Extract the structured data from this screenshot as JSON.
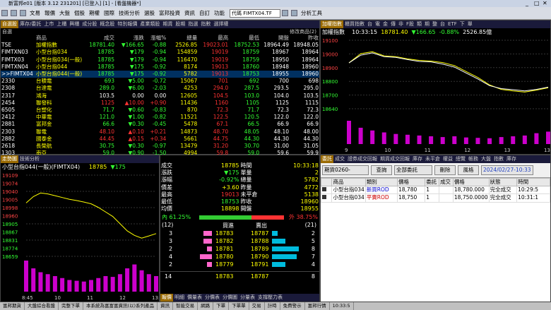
{
  "window": {
    "title": "新富邦e01 [版本 3.12 231201] [已登入] [1] - [看盤機器*]"
  },
  "menu": {
    "items": [
      "文易",
      "報價",
      "大盤",
      "個股",
      "期權",
      "國際",
      "技術分析",
      "選股",
      "富邦投資",
      "資訊",
      "自訂",
      "功能"
    ],
    "search_value": "代碼 FIMTX04.TF",
    "chart_label": "分析工具"
  },
  "quote": {
    "tabs": [
      "自選股",
      "庫存/委託",
      "上市",
      "上櫃",
      "興櫃",
      "成分股",
      "概念股",
      "特別報價",
      "產業類股",
      "期貨",
      "股期",
      "指選",
      "指數",
      "選擇權"
    ],
    "section_label": "自選",
    "date_label": "修改商品(2)",
    "headers": [
      "商品",
      "成交",
      "漲跌",
      "漲幅%",
      "總量",
      "最高",
      "最低",
      "開盤",
      "昨收"
    ],
    "rows": [
      {
        "code": "TSE",
        "name": "加權指數",
        "price": "18781.40",
        "chg": "▼166.65",
        "pct": "-0.88",
        "vol": "2526.85",
        "high": "19023.01",
        "low": "18752.53",
        "open": "18964.49",
        "prev": "18948.05"
      },
      {
        "code": "FIMTXN03",
        "name": "小型台指034",
        "price": "18785",
        "chg": "▼179",
        "pct": "-0.94",
        "vol": "154859",
        "high": "19019",
        "low": "18759",
        "open": "18967",
        "prev": "18964"
      },
      {
        "code": "FIMTX03",
        "name": "小型台指034(一般)",
        "price": "18785",
        "chg": "▼179",
        "pct": "-0.94",
        "vol": "116470",
        "high": "19019",
        "low": "18759",
        "open": "18950",
        "prev": "18964"
      },
      {
        "code": "FIMTXN04",
        "name": "小型台指044",
        "price": "18785",
        "chg": "▼175",
        "pct": "-0.92",
        "vol": "8174",
        "high": "19013",
        "low": "18760",
        "open": "18948",
        "prev": "18960"
      },
      {
        "code": ">>FIMTX04",
        "name": "小型台指044(一般)",
        "price": "18785",
        "chg": "▼175",
        "pct": "-0.92",
        "vol": "5782",
        "high": "19013",
        "low": "18753",
        "open": "18955",
        "prev": "18960"
      },
      {
        "code": "2330",
        "name": "台積電",
        "price": "693",
        "chg": "▼5.00",
        "pct": "-0.72",
        "vol": "15067",
        "high": "701",
        "low": "692",
        "open": "700",
        "prev": "698"
      },
      {
        "code": "2308",
        "name": "台達電",
        "price": "289.0",
        "chg": "▼6.00",
        "pct": "-2.03",
        "vol": "4253",
        "high": "294.0",
        "low": "287.5",
        "open": "293.5",
        "prev": "295.0"
      },
      {
        "code": "2317",
        "name": "鴻海",
        "price": "103.5",
        "chg": "0.00",
        "pct": "0.00",
        "vol": "12605",
        "high": "104.5",
        "low": "103.0",
        "open": "104.0",
        "prev": "103.5"
      },
      {
        "code": "2454",
        "name": "聯發科",
        "price": "1125",
        "chg": "▲10.00",
        "pct": "+0.90",
        "vol": "11436",
        "high": "1160",
        "low": "1105",
        "open": "1125",
        "prev": "1115"
      },
      {
        "code": "6505",
        "name": "台塑化",
        "price": "71.7",
        "chg": "▼0.60",
        "pct": "-0.83",
        "vol": "870",
        "high": "72.3",
        "low": "71.7",
        "open": "72.3",
        "prev": "72.3"
      },
      {
        "code": "2412",
        "name": "中華電",
        "price": "121.0",
        "chg": "▼1.00",
        "pct": "-0.82",
        "vol": "11521",
        "high": "122.5",
        "low": "120.5",
        "open": "122.0",
        "prev": "122.0"
      },
      {
        "code": "2881",
        "name": "富邦金",
        "price": "66.6",
        "chg": "▼0.30",
        "pct": "-0.45",
        "vol": "5478",
        "high": "67.1",
        "low": "66.5",
        "open": "66.9",
        "prev": "66.9"
      },
      {
        "code": "2303",
        "name": "聯電",
        "price": "48.10",
        "chg": "▲0.10",
        "pct": "+0.21",
        "vol": "14873",
        "high": "48.70",
        "low": "48.05",
        "open": "48.10",
        "prev": "48.00"
      },
      {
        "code": "2882",
        "name": "國泰金",
        "price": "44.45",
        "chg": "▲0.15",
        "pct": "+0.34",
        "vol": "5661",
        "high": "44.75",
        "low": "44.30",
        "open": "44.30",
        "prev": "44.30"
      },
      {
        "code": "2618",
        "name": "長榮航",
        "price": "30.75",
        "chg": "▼0.30",
        "pct": "-0.97",
        "vol": "13479",
        "high": "31.20",
        "low": "30.70",
        "open": "31.00",
        "prev": "31.05"
      },
      {
        "code": "1303",
        "name": "南亞",
        "price": "59.0",
        "chg": "▼0.90",
        "pct": "-1.50",
        "vol": "4994",
        "high": "59.8",
        "low": "59.0",
        "open": "59.6",
        "prev": "59.9"
      },
      {
        "code": "1301",
        "name": "台塑",
        "price": "71.1",
        "chg": "▼0.60",
        "pct": "-0.83",
        "vol": "2553",
        "high": "71.9",
        "low": "71.5",
        "open": "71.9",
        "prev": "71.7"
      },
      {
        "code": "2002",
        "name": "中鋼",
        "price": "24.60",
        "chg": "▼0.30",
        "pct": "-1.20",
        "vol": "11492",
        "high": "24.80",
        "low": "24.60",
        "open": "24.80",
        "prev": "24.90"
      },
      {
        "code": "3008",
        "name": "大立光",
        "price": "2615",
        "chg": "▼10.00",
        "pct": "-0.38",
        "vol": "640",
        "high": "2665",
        "low": "2615",
        "open": "2650",
        "prev": "2625"
      }
    ]
  },
  "index_panel": {
    "tabs": [
      "加權指數",
      "櫃買指數",
      "台",
      "電",
      "金",
      "傳",
      "非",
      "F股",
      "類",
      "期",
      "整",
      "台",
      "ETF",
      "下",
      "單"
    ],
    "title": "加權指數",
    "time": "10:33:15",
    "price": "18781.40",
    "chg": "▼166.65",
    "pct": "-0.88%",
    "vol": "2526.85億",
    "chart_data": {
      "type": "line",
      "title": "加權指數",
      "y_ticks": [
        "19100",
        "19000",
        "18900",
        "18800",
        "18700",
        "18640"
      ],
      "x_ticks": [
        "9",
        "10",
        "11",
        "12",
        "13",
        "13:30"
      ],
      "ylim": [
        18640,
        19100
      ],
      "series": [
        {
          "values": [
            18948,
            19010,
            19023,
            18995,
            18990,
            18975,
            18965,
            18960,
            18950,
            18930,
            18890,
            18850,
            18800,
            18770,
            18760,
            18752,
            18765,
            18781
          ]
        },
        {
          "values": [
            18948,
            19000,
            19015,
            18990,
            18985,
            18970,
            18958,
            18955,
            18940,
            18920,
            18880,
            18840,
            18795,
            18775,
            18768,
            18760,
            18770,
            18785
          ]
        }
      ],
      "volume": [
        60,
        42,
        35,
        30,
        26,
        24,
        22,
        20,
        18,
        20,
        17,
        16,
        15,
        18,
        20,
        22,
        28,
        32
      ]
    }
  },
  "tick_panel": {
    "tabs": [
      "走勢圖",
      "技術分析"
    ],
    "title": "小型台指044(一般)(FIMTX04)",
    "price": "18785",
    "chg": "▼175",
    "chart_data": {
      "type": "line",
      "y_ticks": [
        "19109",
        "19074",
        "19040",
        "19005",
        "18998",
        "18960",
        "18905",
        "18867",
        "18831",
        "18774",
        "18659"
      ],
      "x_ticks": [
        "8:45",
        "10",
        "11",
        "12",
        "13:45"
      ],
      "ylim": [
        18659,
        19109
      ],
      "series": [
        {
          "values": [
            18955,
            18990,
            19010,
            19005,
            18995,
            18985,
            18975,
            18968,
            18960,
            18950,
            18930,
            18905,
            18880,
            18840,
            18800,
            18775,
            18760,
            18772,
            18785
          ]
        }
      ],
      "volume": [
        80,
        60,
        50,
        45,
        40,
        35,
        30,
        28,
        26,
        30,
        35,
        40,
        38,
        45,
        60,
        70,
        55,
        45,
        40
      ]
    }
  },
  "detail": {
    "rows": [
      [
        "成交",
        "18785",
        "時間",
        "10:33:18"
      ],
      [
        "漲跌",
        "▼175",
        "單量",
        "2"
      ],
      [
        "漲幅",
        "-0.92%",
        "總量",
        "5782"
      ],
      [
        "價差",
        "+3.60",
        "昨量",
        "4772"
      ],
      [
        "最高",
        "19013",
        "未平倉",
        "5138"
      ],
      [
        "最低",
        "18753",
        "昨收",
        "18960"
      ],
      [
        "均價",
        "18898",
        "開盤",
        "18955"
      ]
    ],
    "in_label": "內 61.25%",
    "out_label": "外 38.75%",
    "in_pct": 61.25,
    "bid_count": "(12)",
    "ask_count": "(21)",
    "bid_label": "買進",
    "ask_label": "賣出",
    "book": [
      {
        "bq": "3",
        "bid": "18783",
        "ask": "18787",
        "aq": "2",
        "bw": 10,
        "aw": 5
      },
      {
        "bq": "3",
        "bid": "18782",
        "ask": "18788",
        "aq": "5",
        "bw": 10,
        "aw": 12
      },
      {
        "bq": "2",
        "bid": "18781",
        "ask": "18789",
        "aq": "8",
        "bw": 6,
        "aw": 24
      },
      {
        "bq": "4",
        "bid": "18780",
        "ask": "18790",
        "aq": "7",
        "bw": 14,
        "aw": 22
      },
      {
        "bq": "2",
        "bid": "18779",
        "ask": "18791",
        "aq": "4",
        "bw": 6,
        "aw": 12
      }
    ],
    "total": {
      "bq": "14",
      "bid": "18783",
      "ask": "18787",
      "aq": "8"
    },
    "bottom_tabs": [
      "報價",
      "明細",
      "價量表",
      "分價表",
      "分價圖",
      "分量表",
      "支撐壓力表"
    ]
  },
  "orders": {
    "tabs": [
      "委託",
      "成交",
      "證券成交回報",
      "期貨成交回報",
      "庫存",
      "未平倉",
      "權益",
      "總覽",
      "帳務",
      "大盤",
      "指數",
      "庫存"
    ],
    "select_value": "期貨0260-",
    "query_label": "查詢",
    "filter_value": "全部委託",
    "delete_label": "刪除",
    "risk_label": "風格",
    "date_value": "2024/02/27-10:33",
    "headers": [
      "",
      "商品",
      "類別",
      "價格",
      "委託",
      "成交",
      "價格",
      "狀態",
      "時間"
    ],
    "rows": [
      [
        "",
        "小型台指034",
        "新買ROD",
        "18,780",
        "1",
        "",
        "18,780.000",
        "完全成交",
        "10:29:5"
      ],
      [
        "",
        "小型台指034",
        "平賣ROD",
        "18,750",
        "1",
        "",
        "18,750.0000",
        "完全成交",
        "10:31:1"
      ]
    ]
  },
  "status": {
    "items": [
      "富邦期貨",
      "大盤綜合看盤",
      "完整下單",
      "本系統為富富富資訊(以)系列產品",
      "資訊",
      "智能交易",
      "網路",
      "下單",
      "下單單",
      "交易",
      "計時",
      "免費警示",
      "富邦行情",
      "10:33:5"
    ]
  },
  "colors": {
    "up": "#ff3333",
    "down": "#33ff33",
    "accent": "#ffff00",
    "tab_active": "#9a6a00"
  }
}
